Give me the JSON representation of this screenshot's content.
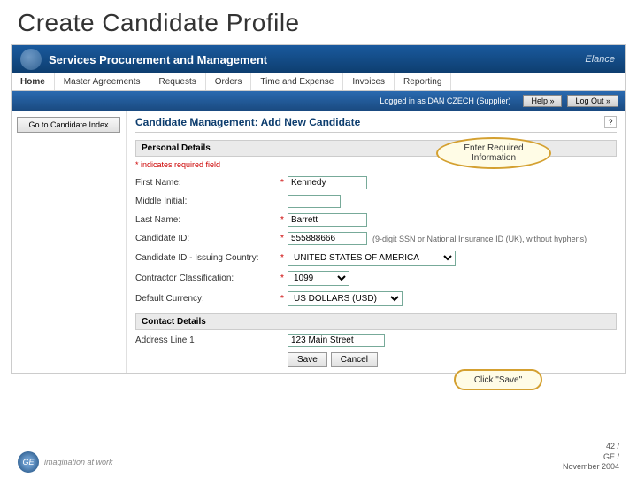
{
  "slide": {
    "title": "Create Candidate Profile"
  },
  "banner": {
    "title": "Services Procurement and Management",
    "logo": "Elance"
  },
  "tabs": [
    "Home",
    "Master Agreements",
    "Requests",
    "Orders",
    "Time and Expense",
    "Invoices",
    "Reporting"
  ],
  "userbar": {
    "text": "Logged in as DAN CZECH (Supplier)",
    "help": "Help »",
    "logout": "Log Out »"
  },
  "left": {
    "goBtn": "Go to Candidate Index"
  },
  "page": {
    "heading": "Candidate Management: Add New Candidate",
    "help": "?"
  },
  "sections": {
    "personal": "Personal Details",
    "contact": "Contact Details"
  },
  "reqNote": "* indicates required field",
  "fields": {
    "firstName": {
      "label": "First Name:",
      "value": "Kennedy"
    },
    "middle": {
      "label": "Middle Initial:",
      "value": ""
    },
    "lastName": {
      "label": "Last Name:",
      "value": "Barrett"
    },
    "candId": {
      "label": "Candidate ID:",
      "value": "555888666",
      "hint": "(9-digit SSN or National Insurance ID (UK), without hyphens)"
    },
    "country": {
      "label": "Candidate ID - Issuing Country:",
      "value": "UNITED STATES OF AMERICA"
    },
    "classification": {
      "label": "Contractor Classification:",
      "value": "1099"
    },
    "currency": {
      "label": "Default Currency:",
      "value": "US DOLLARS (USD)"
    },
    "addr1": {
      "label": "Address Line 1",
      "value": "123 Main Street"
    }
  },
  "buttons": {
    "save": "Save",
    "cancel": "Cancel"
  },
  "callouts": {
    "c1": "Enter Required Information",
    "c2": "Click \"Save\""
  },
  "footer": {
    "ge": "GE",
    "tagline": "imagination at work",
    "page": "42 /",
    "co": "GE /",
    "date": "November 2004"
  }
}
